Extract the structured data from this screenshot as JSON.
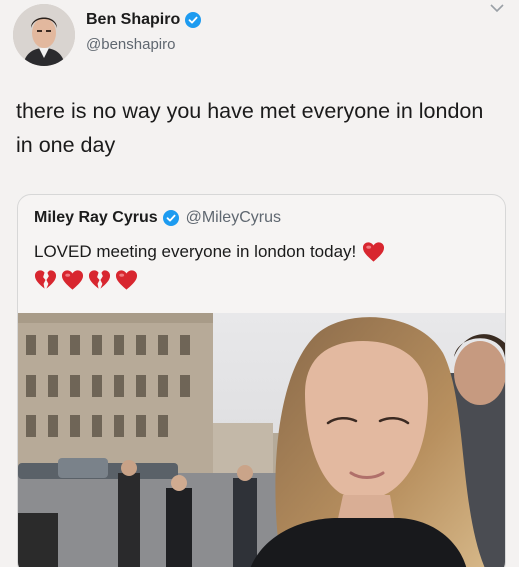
{
  "tweet": {
    "author_name": "Ben Shapiro",
    "author_handle": "@benshapiro",
    "text": "there is no way you have met everyone in london in one day"
  },
  "quoted_tweet": {
    "author_name": "Miley Ray Cyrus",
    "author_handle": "@MileyCyrus",
    "text": "LOVED meeting everyone in london today!",
    "hearts": [
      "broken-heart-icon",
      "heart-icon",
      "broken-heart-icon",
      "heart-icon"
    ]
  },
  "colors": {
    "verified": "#1d9bf0",
    "heart": "#d8262f",
    "handle": "#5f6770"
  }
}
